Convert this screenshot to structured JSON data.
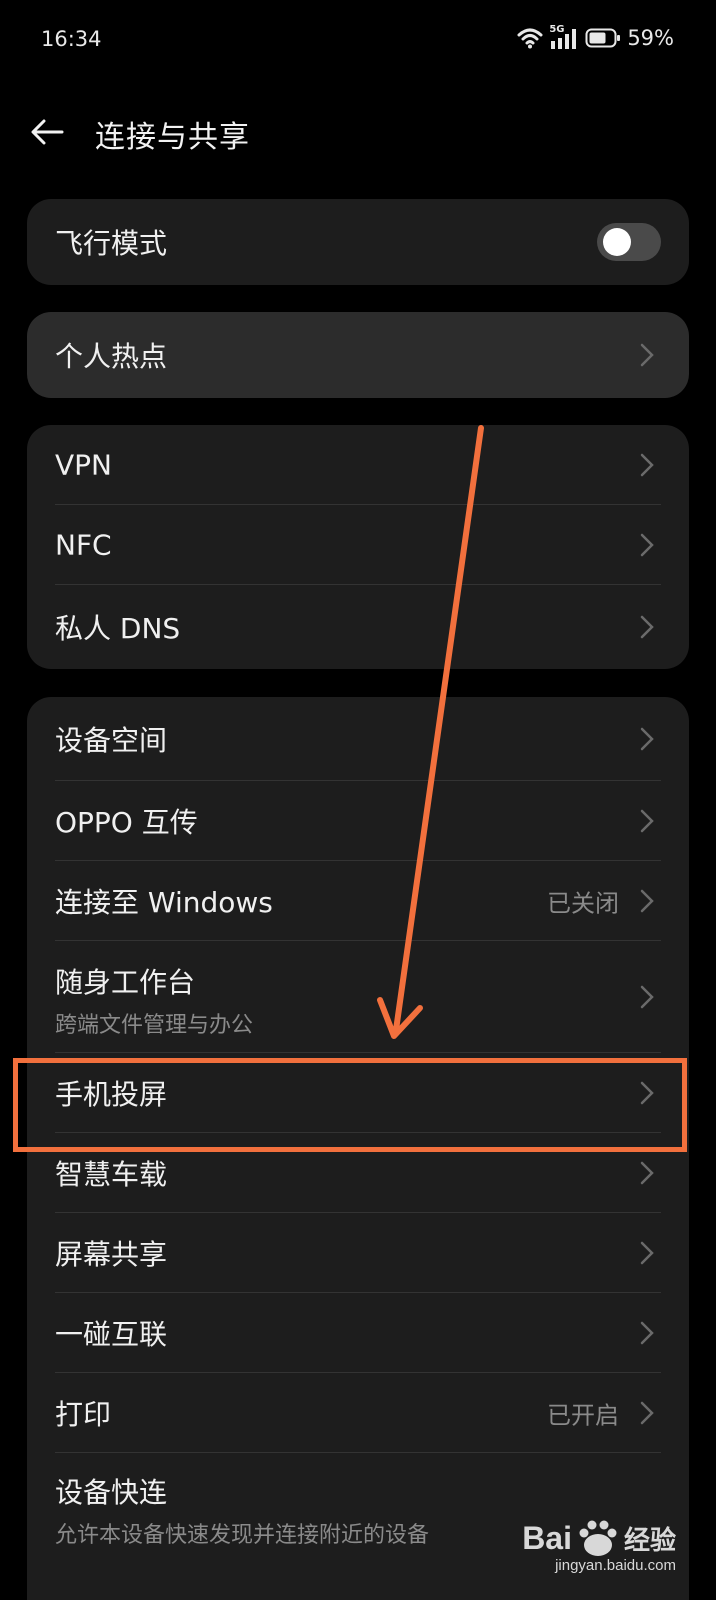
{
  "status_bar": {
    "time": "16:34",
    "signal_label": "5G",
    "battery": "59%",
    "icons": [
      "wifi-icon",
      "signal-icon",
      "battery-icon"
    ]
  },
  "header": {
    "title": "连接与共享",
    "back_icon": "arrow-left-icon"
  },
  "groups": {
    "airplane": {
      "label": "飞行模式",
      "toggle_on": false
    },
    "hotspot": {
      "label": "个人热点"
    },
    "network": [
      {
        "label": "VPN"
      },
      {
        "label": "NFC"
      },
      {
        "label": "私人 DNS"
      }
    ],
    "devices": [
      {
        "label": "设备空间",
        "status": "",
        "subtitle": ""
      },
      {
        "label": "OPPO 互传",
        "status": "",
        "subtitle": ""
      },
      {
        "label": "连接至 Windows",
        "status": "已关闭",
        "subtitle": ""
      },
      {
        "label": "随身工作台",
        "status": "",
        "subtitle": "跨端文件管理与办公"
      },
      {
        "label": "手机投屏",
        "status": "",
        "subtitle": ""
      },
      {
        "label": "智慧车载",
        "status": "",
        "subtitle": ""
      },
      {
        "label": "屏幕共享",
        "status": "",
        "subtitle": ""
      },
      {
        "label": "一碰互联",
        "status": "",
        "subtitle": ""
      },
      {
        "label": "打印",
        "status": "已开启",
        "subtitle": ""
      },
      {
        "label": "设备快连",
        "status": "",
        "subtitle": "允许本设备快速发现并连接附近的设备"
      }
    ]
  },
  "annotation": {
    "color": "#f2703d",
    "highlighted_item": "手机投屏"
  },
  "watermark": {
    "brand": "Bai",
    "brand_suffix": "经验",
    "url": "jingyan.baidu.com"
  },
  "colors": {
    "background": "#000000",
    "card": "#1d1d1d",
    "card_highlight": "#2c2c2c",
    "secondary_text": "#8a8a8a"
  }
}
